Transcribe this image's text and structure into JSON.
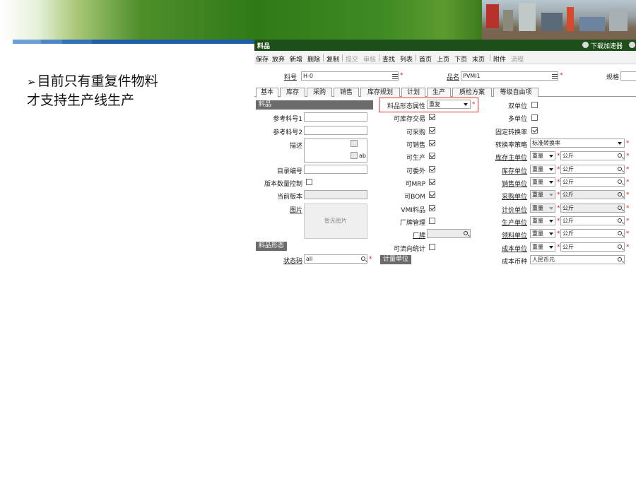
{
  "slide": {
    "bullet_line1": "目前只有重复件物料",
    "bullet_line2": "才支持生产线生产",
    "colors": {
      "banner_green": "#2f7a18",
      "stripe_blue": "#1f5fa8",
      "titlebar": "#1e4f1a",
      "highlight": "#e03030"
    }
  },
  "app": {
    "title": "料品",
    "download_label": "下载加速器",
    "toolbar": [
      "保存",
      "放弃",
      "新增",
      "删除",
      "复制",
      "提交",
      "审核",
      "查找",
      "列表",
      "首页",
      "上页",
      "下页",
      "末页",
      "附件",
      "流程"
    ],
    "toolbar_disabled": [
      "提交",
      "审核",
      "流程"
    ],
    "header": {
      "item_no_label": "料号",
      "item_no_value": "H-0",
      "item_name_label": "品名",
      "item_name_value": "PVMI1",
      "spec_label": "规格"
    },
    "tabs": [
      "基本",
      "库存",
      "采购",
      "销售",
      "库存规划",
      "计划",
      "生产",
      "质检方案",
      "等级自由项"
    ],
    "active_tab": "基本",
    "left": {
      "section_title": "料品",
      "ref1_label": "参考料号1",
      "ref2_label": "参考料号2",
      "desc_label": "描述",
      "desc_ab": "ab",
      "catalog_label": "目录编号",
      "version_ctrl_label": "版本数量控制",
      "current_version_label": "当前版本",
      "image_label": "图片",
      "image_placeholder": "暂无图片",
      "form_section_title": "料品形态",
      "status_label": "状态码",
      "status_value": "all"
    },
    "middle": {
      "form_attr_label": "料品形态属性",
      "form_attr_value": "重复",
      "checks": [
        {
          "label": "可库存交易",
          "checked": true
        },
        {
          "label": "可采购",
          "checked": true
        },
        {
          "label": "可销售",
          "checked": true
        },
        {
          "label": "可生产",
          "checked": true
        },
        {
          "label": "可委外",
          "checked": true
        },
        {
          "label": "可MRP",
          "checked": true
        },
        {
          "label": "可BOM",
          "checked": true
        },
        {
          "label": "VMI料品",
          "checked": true
        },
        {
          "label": "厂牌管理",
          "checked": false
        }
      ],
      "brand_label": "厂牌",
      "flow_stat_label": "可流向统计",
      "unit_section_title": "计量单位"
    },
    "right": {
      "dual_unit_label": "双单位",
      "multi_unit_label": "多单位",
      "fixed_rate_label": "固定转换率",
      "rate_policy_label": "转换率策略",
      "rate_policy_value": "标准转换率",
      "units": [
        {
          "label": "库存主单位",
          "type": "重量",
          "unit": "公斤",
          "gray": false
        },
        {
          "label": "库存单位",
          "type": "重量",
          "unit": "公斤",
          "gray": false
        },
        {
          "label": "销售单位",
          "type": "重量",
          "unit": "公斤",
          "gray": false
        },
        {
          "label": "采购单位",
          "type": "重量",
          "unit": "公斤",
          "gray": true
        },
        {
          "label": "计价单位",
          "type": "重量",
          "unit": "公斤",
          "gray": true
        },
        {
          "label": "生产单位",
          "type": "重量",
          "unit": "公斤",
          "gray": false
        },
        {
          "label": "领料单位",
          "type": "重量",
          "unit": "公斤",
          "gray": false
        },
        {
          "label": "成本单位",
          "type": "重量",
          "unit": "公斤",
          "gray": false
        }
      ],
      "currency_label": "成本币种",
      "currency_value": "人民币元"
    }
  }
}
